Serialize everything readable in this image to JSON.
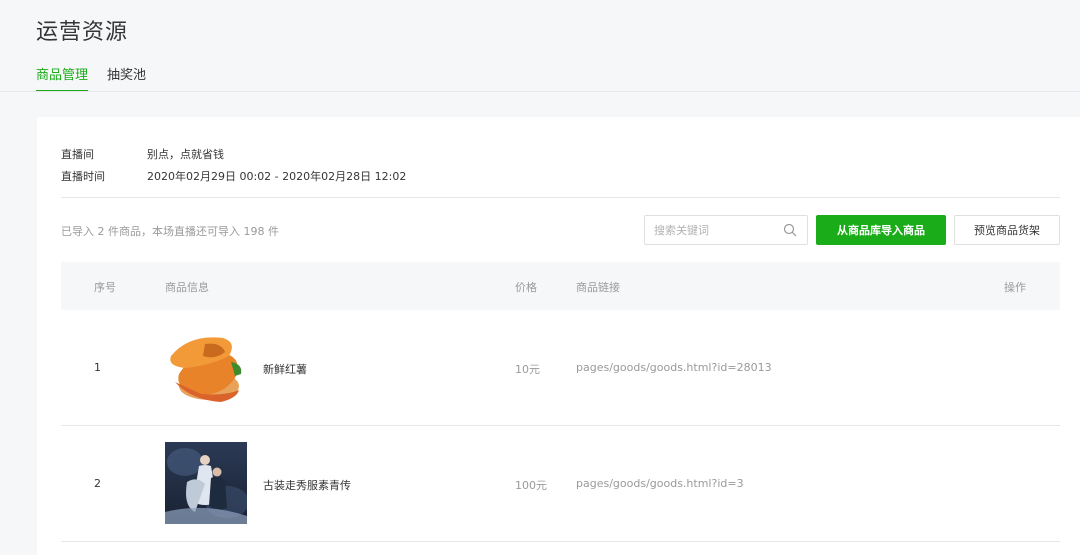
{
  "page": {
    "title": "运营资源"
  },
  "tabs": [
    {
      "label": "商品管理",
      "active": true
    },
    {
      "label": "抽奖池",
      "active": false
    }
  ],
  "info": {
    "room_label": "直播间",
    "room_value": "别点，点就省钱",
    "time_label": "直播时间",
    "time_value": "2020年02月29日 00:02 - 2020年02月28日 12:02"
  },
  "summary": "已导入 2 件商品，本场直播还可导入 198 件",
  "search": {
    "placeholder": "搜索关键词",
    "value": ""
  },
  "buttons": {
    "import_label": "从商品库导入商品",
    "preview_label": "预览商品货架"
  },
  "table": {
    "headers": {
      "no": "序号",
      "info": "商品信息",
      "price": "价格",
      "link": "商品链接",
      "op": "操作"
    },
    "rows": [
      {
        "no": "1",
        "name": "新鲜红薯",
        "price": "10元",
        "link": "pages/goods/goods.html?id=28013",
        "thumb_icon": "sweet-potato-image"
      },
      {
        "no": "2",
        "name": "古装走秀服素青传",
        "price": "100元",
        "link": "pages/goods/goods.html?id=3",
        "thumb_icon": "costume-photo-image"
      }
    ]
  },
  "colors": {
    "accent": "#1aad19",
    "muted": "#9a9a9a",
    "text": "#353535",
    "bg": "#f6f7f9"
  }
}
